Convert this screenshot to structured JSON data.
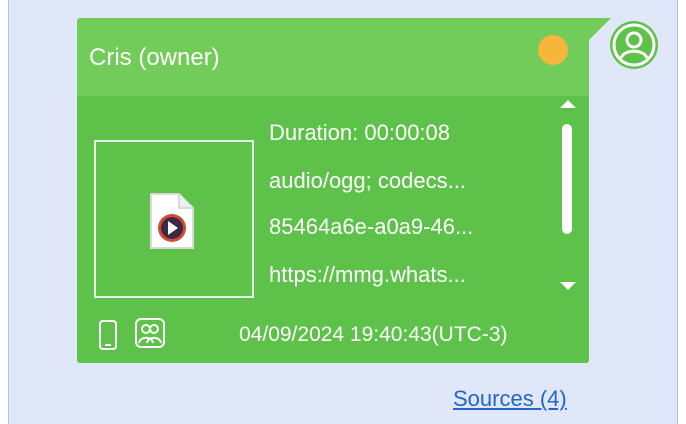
{
  "message": {
    "sender": "Cris (owner)",
    "status_color": "#f6b63b",
    "bubble_color": "#5ec24a",
    "header_color": "#72cc59",
    "attachment": {
      "icon": "audio-file-icon",
      "duration": "Duration: 00:00:08",
      "mime": "audio/ogg; codecs...",
      "id": "85464a6e-a0a9-46...",
      "url": "https://mmg.whats..."
    },
    "source_device_icon": "phone-icon",
    "group_icon": "group-icon",
    "timestamp": "04/09/2024 19:40:43(UTC-3)"
  },
  "avatar_icon": "user-avatar-icon",
  "sources_link": "Sources (4)"
}
